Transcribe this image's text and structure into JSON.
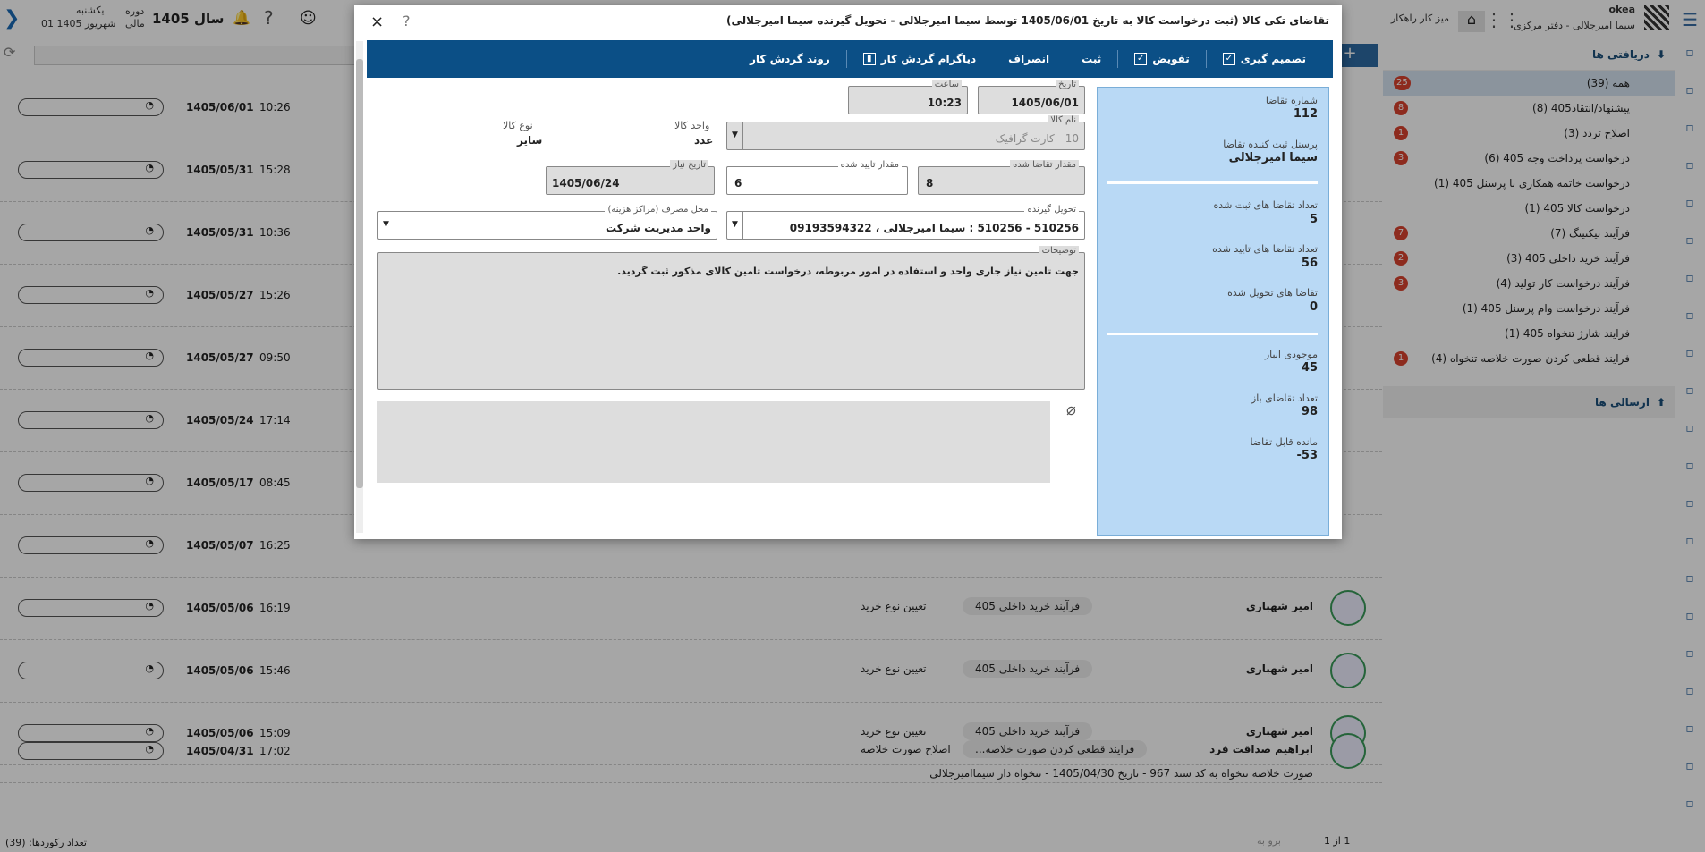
{
  "topbar": {
    "app_name": "okea",
    "org": "سیما امیرجلالی - دفتر مرکزی",
    "desk": "میز کار راهکار",
    "year": "سال 1405",
    "period_label": "دوره",
    "period_sub": "مالی",
    "weekday": "یکشنبه",
    "date": "01 شهریور 1405"
  },
  "rpanel": {
    "inbox_title": "دریافتی ها",
    "sent_title": "ارسالی ها",
    "items": [
      {
        "label": "همه (39)",
        "badge": "25"
      },
      {
        "label": "پیشنهاد/انتقاد405 (8)",
        "badge": "8"
      },
      {
        "label": "اصلاح تردد (3)",
        "badge": "1"
      },
      {
        "label": "درخواست پرداخت وجه 405 (6)",
        "badge": "3"
      },
      {
        "label": "درخواست خاتمه همکاری با پرسنل 405 (1)",
        "badge": ""
      },
      {
        "label": "درخواست کالا 405 (1)",
        "badge": ""
      },
      {
        "label": "فرآیند تیکتینگ (7)",
        "badge": "7"
      },
      {
        "label": "فرآیند خرید داخلی 405 (3)",
        "badge": "2"
      },
      {
        "label": "فرآیند درخواست کار تولید (4)",
        "badge": "3"
      },
      {
        "label": "فرآیند درخواست وام پرسنل 405 (1)",
        "badge": ""
      },
      {
        "label": "فرایند شارژ تنخواه 405 (1)",
        "badge": ""
      },
      {
        "label": "فرایند قطعی کردن صورت خلاصه تنخواه (4)",
        "badge": "1"
      }
    ]
  },
  "list": {
    "rows": [
      {
        "date": "1405/06/01",
        "time": "10:26"
      },
      {
        "date": "1405/05/31",
        "time": "15:28"
      },
      {
        "date": "1405/05/31",
        "time": "10:36"
      },
      {
        "date": "1405/05/27",
        "time": "15:26"
      },
      {
        "date": "1405/05/27",
        "time": "09:50"
      },
      {
        "date": "1405/05/24",
        "time": "17:14"
      },
      {
        "date": "1405/05/17",
        "time": "08:45"
      },
      {
        "date": "1405/05/07",
        "time": "16:25"
      },
      {
        "date": "1405/05/06",
        "time": "16:19",
        "who": "امیر شهبازی",
        "proc": "فرآیند خرید داخلی 405",
        "step": "تعیین نوع خرید"
      },
      {
        "date": "1405/05/06",
        "time": "15:46",
        "who": "امیر شهبازی",
        "proc": "فرآیند خرید داخلی 405",
        "step": "تعیین نوع خرید"
      },
      {
        "date": "1405/05/06",
        "time": "15:09",
        "who": "امیر شهبازی",
        "proc": "فرآیند خرید داخلی 405",
        "step": "تعیین نوع خرید"
      },
      {
        "date": "1405/04/31",
        "time": "17:02",
        "who": "ابراهیم صداقت فرد",
        "proc": "فرایند قطعی کردن صورت خلاصه...",
        "step": "اصلاح صورت خلاصه",
        "sub": "صورت خلاصه تنخواه به کد سند 967 - تاریخ 1405/04/30 - تنخواه دار سیماامیرجلالی"
      }
    ],
    "footer_count": "تعداد رکوردها: (39)",
    "pager": "1 از 1",
    "pager_go": "برو به"
  },
  "modal": {
    "title": "تقاضای تکی کالا (ثبت درخواست کالا به تاریخ 1405/06/01 توسط سیما امیرجلالی - تحویل گیرنده سیما امیرجلالی)",
    "help": "?",
    "close": "×",
    "toolbar": {
      "decide": "تصمیم گیری",
      "delegate": "تفویض",
      "save": "ثبت",
      "cancel": "انصراف",
      "diagram": "دیاگرام گردش کار",
      "flow": "روند گردش کار"
    },
    "side": {
      "req_no_label": "شماره تقاضا",
      "req_no": "112",
      "creator_label": "پرسنل ثبت کننده تقاضا",
      "creator": "سیما امیرجلالی",
      "registered_label": "تعداد تقاضا های ثبت شده",
      "registered": "5",
      "approved_label": "تعداد تقاضا های تایید شده",
      "approved": "56",
      "delivered_label": "تقاضا های تحویل شده",
      "delivered": "0",
      "stock_label": "موجودی انبار",
      "stock": "45",
      "open_label": "تعداد تقاضای باز",
      "open": "98",
      "remain_label": "مانده قابل تقاضا",
      "remain": "53-"
    },
    "form": {
      "date_label": "تاریخ",
      "date": "1405/06/01",
      "time_label": "ساعت",
      "time": "10:23",
      "item_label": "نام کالا",
      "item": "10 - کارت گرافیک",
      "unit_label": "واحد کالا",
      "unit": "عدد",
      "type_label": "نوع کالا",
      "type": "سایر",
      "qty_label": "مقدار تقاضا شده",
      "qty": "8",
      "approved_qty_label": "مقدار تایید شده",
      "approved_qty": "6",
      "need_date_label": "تاریخ نیاز",
      "need_date": "1405/06/24",
      "receiver_label": "تحویل گیرنده",
      "receiver": "510256 - 510256 : سیما امیرجلالی ، 09193594322",
      "cost_label": "محل مصرف (مراکز هزینه)",
      "cost": "واحد مدیریت شرکت",
      "desc_label": "توضیحات",
      "desc": "جهت تامین نیاز جاری واحد و استفاده در امور مربوطه، درخواست تامین کالای مذکور ثبت گردید."
    }
  }
}
